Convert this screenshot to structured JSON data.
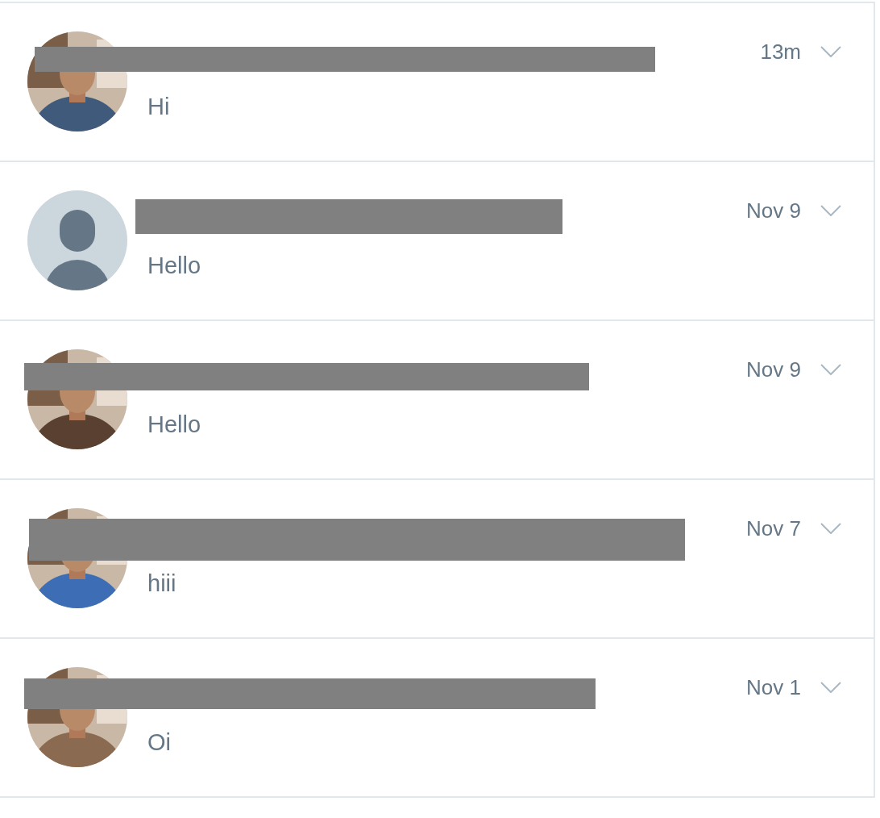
{
  "messages": [
    {
      "name_redacted": true,
      "time": "13m",
      "text": "Hi"
    },
    {
      "avatar": {
        "kind": "default"
      },
      "name_redacted": true,
      "time": "Nov 9",
      "text": "Hello"
    },
    {
      "name_redacted": true,
      "time": "Nov 9",
      "text": "Hello"
    },
    {
      "name_redacted": true,
      "time": "Nov 7",
      "text": "hiii"
    },
    {
      "name_redacted": true,
      "time": "Nov 1",
      "text": "Oi"
    }
  ]
}
